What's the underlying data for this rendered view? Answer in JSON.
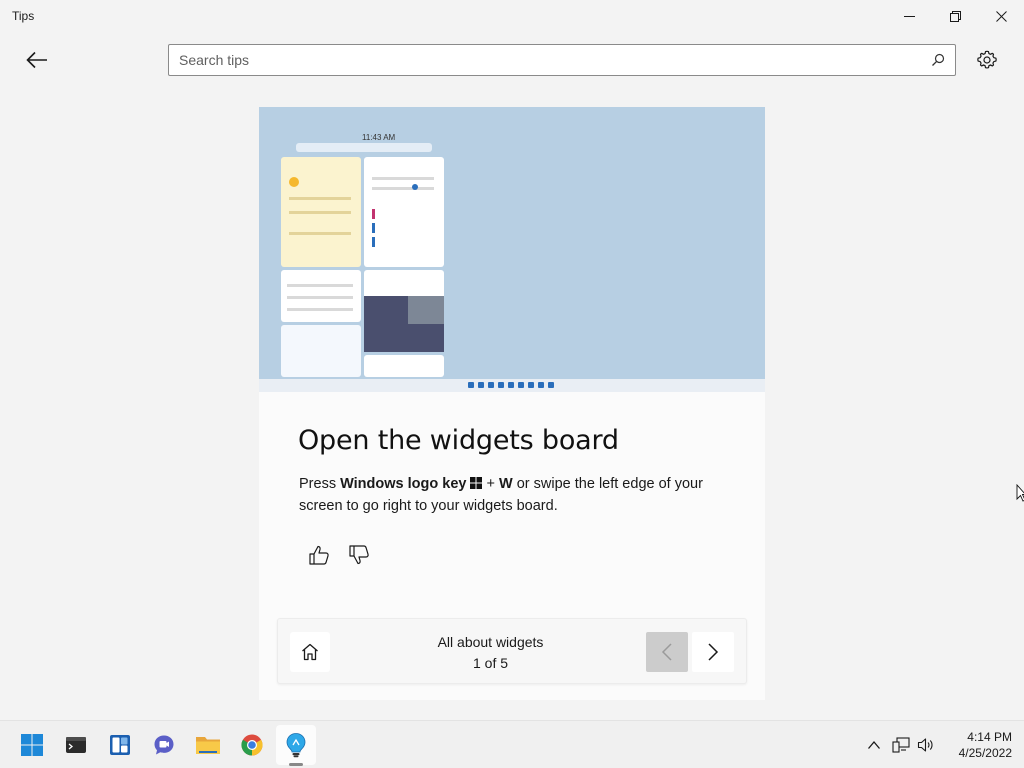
{
  "window": {
    "title": "Tips",
    "minimize_icon": "minimize-icon",
    "maximize_icon": "restore-icon",
    "close_icon": "close-icon"
  },
  "header": {
    "back_icon": "back-arrow-icon",
    "search_placeholder": "Search tips",
    "search_value": "",
    "settings_icon": "gear-icon"
  },
  "tip": {
    "title": "Open the widgets board",
    "body_prefix": "Press ",
    "body_key": "Windows logo key",
    "body_plus": " + ",
    "body_letter": "W",
    "body_suffix": " or swipe the left edge of your screen to go right to your widgets board.",
    "image_time": "11:43 AM",
    "like_icon": "thumbs-up-icon",
    "dislike_icon": "thumbs-down-icon"
  },
  "collection": {
    "name": "All about widgets",
    "position": "1 of 5",
    "home_icon": "home-icon",
    "prev_icon": "chevron-left-icon",
    "next_icon": "chevron-right-icon"
  },
  "taskbar": {
    "apps": [
      "start",
      "terminal",
      "widgets",
      "teams-chat",
      "file-explorer",
      "chrome",
      "tips"
    ],
    "active_app": "tips",
    "time": "4:14 PM",
    "date": "4/25/2022"
  },
  "colors": {
    "accent": "#0067c0",
    "hero_bg": "#b7cfe3",
    "window_bg": "#f3f3f3"
  }
}
